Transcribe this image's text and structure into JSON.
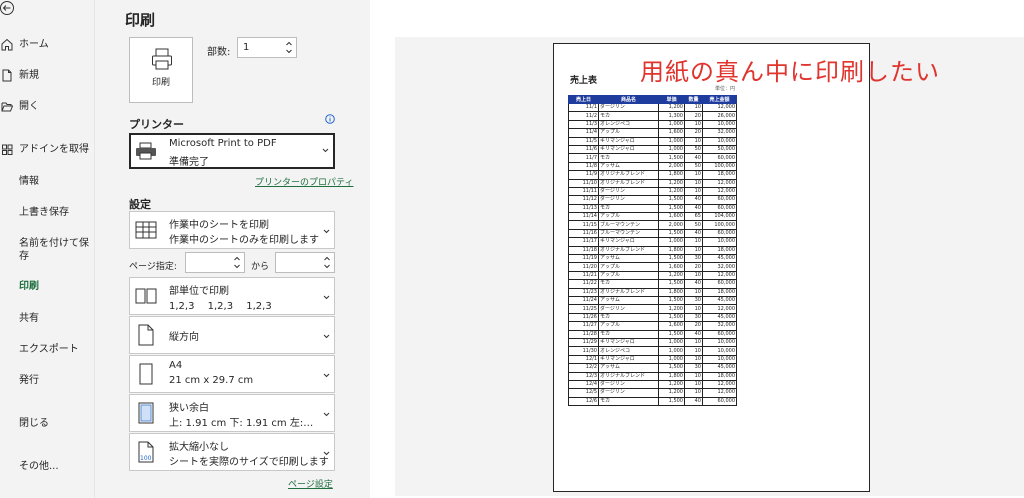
{
  "nav": {
    "items": [
      {
        "label": "ホーム",
        "icon": "home-icon"
      },
      {
        "label": "新規",
        "icon": "new-file-icon"
      },
      {
        "label": "開く",
        "icon": "folder-open-icon"
      },
      {
        "label": "アドインを取得",
        "icon": "addin-grid-icon"
      },
      {
        "label": "情報"
      },
      {
        "label": "上書き保存"
      },
      {
        "label": "名前を付けて保存"
      },
      {
        "label": "印刷"
      },
      {
        "label": "共有"
      },
      {
        "label": "エクスポート"
      },
      {
        "label": "発行"
      },
      {
        "label": "閉じる"
      },
      {
        "label": "その他..."
      }
    ]
  },
  "print": {
    "title": "印刷",
    "button_label": "印刷",
    "copies_label": "部数:",
    "copies_value": "1"
  },
  "printer": {
    "section_title": "プリンター",
    "name": "Microsoft Print to PDF",
    "status": "準備完了",
    "properties_link": "プリンターのプロパティ"
  },
  "settings": {
    "section_title": "設定",
    "scope": {
      "line1": "作業中のシートを印刷",
      "line2": "作業中のシートのみを印刷します"
    },
    "pages_label": "ページ指定:",
    "pages_to": "から",
    "collate": {
      "line1": "部単位で印刷",
      "line2": "1,2,3　 1,2,3　 1,2,3"
    },
    "orientation": {
      "line1": "縦方向"
    },
    "paper": {
      "line1": "A4",
      "line2": "21 cm x 29.7 cm"
    },
    "margins": {
      "line1": "狭い余白",
      "line2": "上: 1.91 cm 下: 1.91 cm 左:…"
    },
    "scaling": {
      "line1": "拡大縮小なし",
      "line2": "シートを実際のサイズで印刷します",
      "icon_text": "100"
    },
    "page_setup_link": "ページ設定"
  },
  "preview": {
    "annotation": "用紙の真ん中に印刷したい",
    "sheet_title": "売上表",
    "unit": "単位：円",
    "headers": [
      "売上日",
      "商品名",
      "単価",
      "数量",
      "売上金額"
    ],
    "rows": [
      [
        "11/1",
        "ダージリン",
        "1,200",
        "10",
        "12,000"
      ],
      [
        "11/2",
        "モカ",
        "1,300",
        "20",
        "26,000"
      ],
      [
        "11/3",
        "オレンジペコ",
        "1,000",
        "10",
        "10,000"
      ],
      [
        "11/4",
        "アップル",
        "1,600",
        "20",
        "32,000"
      ],
      [
        "11/5",
        "キリマンジャロ",
        "1,000",
        "10",
        "10,000"
      ],
      [
        "11/6",
        "キリマンジャロ",
        "1,000",
        "50",
        "50,000"
      ],
      [
        "11/7",
        "モカ",
        "1,500",
        "40",
        "60,000"
      ],
      [
        "11/8",
        "アッサム",
        "2,000",
        "50",
        "100,000"
      ],
      [
        "11/9",
        "オリジナルブレンド",
        "1,800",
        "10",
        "18,000"
      ],
      [
        "11/10",
        "オリジナルブレンド",
        "1,200",
        "10",
        "12,000"
      ],
      [
        "11/11",
        "ダージリン",
        "1,200",
        "10",
        "12,000"
      ],
      [
        "11/12",
        "ダージリン",
        "1,500",
        "40",
        "60,000"
      ],
      [
        "11/13",
        "モカ",
        "1,500",
        "40",
        "60,000"
      ],
      [
        "11/14",
        "アップル",
        "1,600",
        "65",
        "104,000"
      ],
      [
        "11/15",
        "ブルーマウンテン",
        "2,000",
        "50",
        "100,000"
      ],
      [
        "11/16",
        "ブルーマウンテン",
        "1,500",
        "40",
        "60,000"
      ],
      [
        "11/17",
        "キリマンジャロ",
        "1,000",
        "10",
        "10,000"
      ],
      [
        "11/18",
        "オリジナルブレンド",
        "1,800",
        "10",
        "18,000"
      ],
      [
        "11/19",
        "アッサム",
        "1,500",
        "30",
        "45,000"
      ],
      [
        "11/20",
        "アップル",
        "1,600",
        "20",
        "32,000"
      ],
      [
        "11/21",
        "アップル",
        "1,200",
        "10",
        "12,000"
      ],
      [
        "11/22",
        "モカ",
        "1,500",
        "40",
        "60,000"
      ],
      [
        "11/23",
        "オリジナルブレンド",
        "1,800",
        "10",
        "18,000"
      ],
      [
        "11/24",
        "アッサム",
        "1,500",
        "30",
        "45,000"
      ],
      [
        "11/25",
        "ダージリン",
        "1,200",
        "10",
        "12,000"
      ],
      [
        "11/26",
        "モカ",
        "1,500",
        "30",
        "45,000"
      ],
      [
        "11/27",
        "アップル",
        "1,600",
        "20",
        "32,000"
      ],
      [
        "11/28",
        "モカ",
        "1,500",
        "40",
        "60,000"
      ],
      [
        "11/29",
        "キリマンジャロ",
        "1,000",
        "10",
        "10,000"
      ],
      [
        "11/30",
        "オレンジペコ",
        "1,000",
        "10",
        "10,000"
      ],
      [
        "12/1",
        "キリマンジャロ",
        "1,000",
        "10",
        "10,000"
      ],
      [
        "12/2",
        "アッサム",
        "1,500",
        "30",
        "45,000"
      ],
      [
        "12/3",
        "オリジナルブレンド",
        "1,800",
        "10",
        "18,000"
      ],
      [
        "12/4",
        "ダージリン",
        "1,200",
        "10",
        "12,000"
      ],
      [
        "12/5",
        "ダージリン",
        "1,200",
        "10",
        "12,000"
      ],
      [
        "12/6",
        "モカ",
        "1,500",
        "40",
        "60,000"
      ]
    ]
  }
}
